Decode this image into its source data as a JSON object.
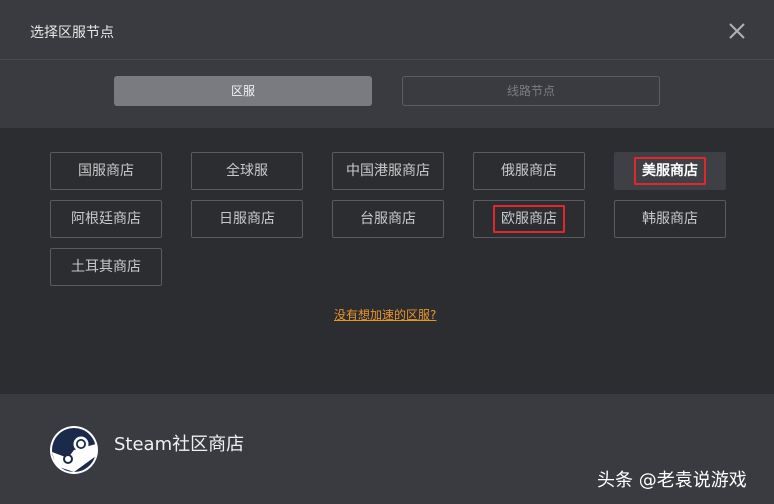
{
  "dialog": {
    "title": "选择区服节点"
  },
  "tabs": [
    {
      "label": "区服",
      "active": true
    },
    {
      "label": "线路节点",
      "active": false
    }
  ],
  "stores": [
    {
      "label": "国服商店"
    },
    {
      "label": "全球服"
    },
    {
      "label": "中国港服商店"
    },
    {
      "label": "俄服商店"
    },
    {
      "label": "美服商店",
      "selected": true
    },
    {
      "label": "阿根廷商店"
    },
    {
      "label": "日服商店"
    },
    {
      "label": "台服商店"
    },
    {
      "label": "欧服商店"
    },
    {
      "label": "韩服商店"
    },
    {
      "label": "土耳其商店"
    }
  ],
  "help_link": "没有想加速的区服?",
  "footer": {
    "app_name": "Steam社区商店",
    "watermark": "头条 @老袁说游戏"
  },
  "colors": {
    "accent_link": "#e8942c",
    "highlight_box": "#e0282a",
    "panel_bg": "#2c2d31",
    "dialog_bg": "#3a3b40"
  },
  "icons": {
    "close": "close-icon",
    "steam": "steam-logo-icon"
  }
}
